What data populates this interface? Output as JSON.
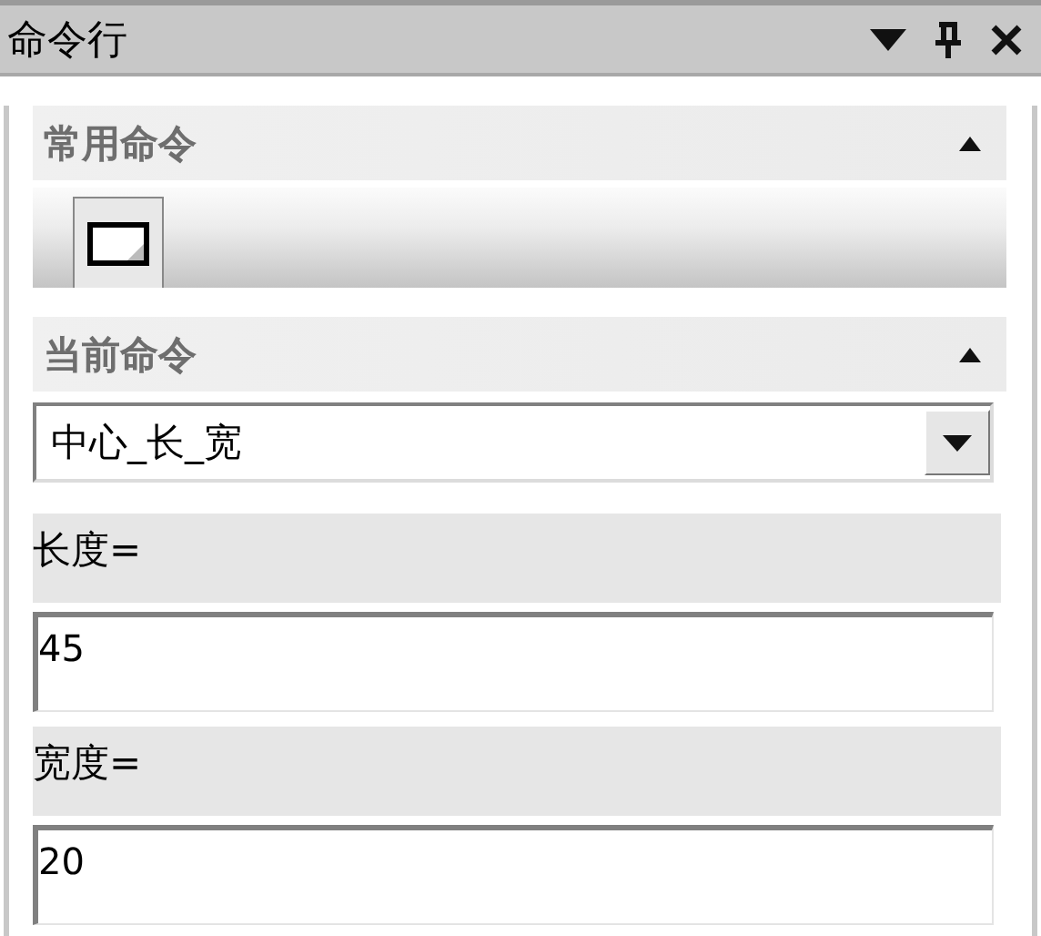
{
  "window": {
    "title": "命令行"
  },
  "sections": [
    {
      "kind": "toolbar",
      "title": "常用命令",
      "expanded": true,
      "tools": [
        {
          "kind": "rectangle"
        }
      ]
    },
    {
      "kind": "form",
      "title": "当前命令",
      "expanded": true,
      "command": "中心_长_宽",
      "params": [
        {
          "label": "长度=",
          "value": "45"
        },
        {
          "label": "宽度=",
          "value": "20"
        }
      ]
    }
  ]
}
